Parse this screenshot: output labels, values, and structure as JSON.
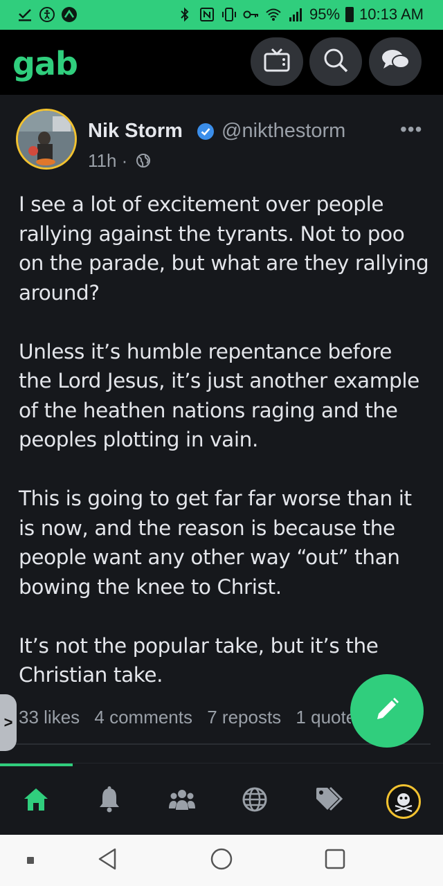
{
  "status_bar": {
    "battery": "95%",
    "time": "10:13 AM"
  },
  "app": {
    "logo": "gab",
    "brand_color": "#30ce7d"
  },
  "top_nav": {
    "buttons": [
      "tv-icon",
      "search-icon",
      "chat-icon"
    ]
  },
  "post": {
    "author": {
      "name": "Nik Storm",
      "handle": "@nikthestorm",
      "verified": true
    },
    "time": "11h ·",
    "more_label": "•••",
    "paragraphs": [
      "I see a lot of excitement over people rallying against the tyrants. Not to poo on the parade, but what are they rallying around?",
      "Unless it’s humble repentance before the Lord Jesus, it’s just another example of the heathen nations raging and the peoples plotting in vain.",
      "This is going to get far far worse than it is now, and the reason is because the people want any other way “out” than bowing the knee to Christ.",
      "It’s not the popular take, but it’s the Christian take."
    ],
    "stats": {
      "likes": "33 likes",
      "comments": "4 comments",
      "reposts": "7 reposts",
      "quotes": "1 quotes"
    }
  },
  "side_tab": {
    "label": ">"
  },
  "fab": {
    "icon": "pencil-icon"
  },
  "bottom_nav": {
    "items": [
      "home-icon",
      "bell-icon",
      "groups-icon",
      "globe-icon",
      "tag-icon",
      "profile-avatar"
    ],
    "active": "home-icon"
  },
  "android_nav": [
    "recents-dot",
    "back-icon",
    "home-circle",
    "overview-square"
  ]
}
